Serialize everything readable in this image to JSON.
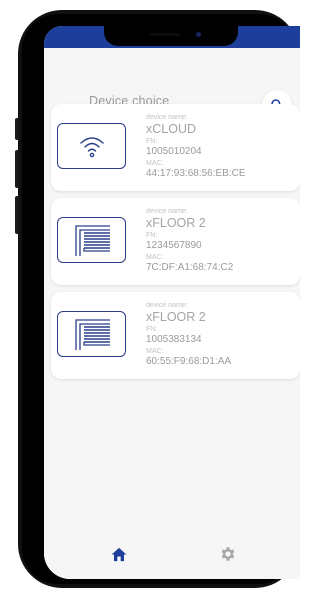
{
  "header": {
    "title": "Device choice"
  },
  "devices": [
    {
      "name_label": "device name:",
      "name": "xCLOUD",
      "fn_label": "FN:",
      "fn": "1005010204",
      "mac_label": "MAC:",
      "mac": "44:17:93:68:56:EB:CE",
      "icon": "wifi-icon"
    },
    {
      "name_label": "device name:",
      "name": "xFLOOR 2",
      "fn_label": "FN:",
      "fn": "1234567890",
      "mac_label": "MAC:",
      "mac": "7C:DF:A1:68:74:C2",
      "icon": "floor-heating-icon"
    },
    {
      "name_label": "device name:",
      "name": "xFLOOR 2",
      "fn_label": "FN:",
      "fn": "1005383134",
      "mac_label": "MAC:",
      "mac": "60:55:F9:68:D1:AA",
      "icon": "floor-heating-icon"
    }
  ],
  "tabbar": {
    "home_icon": "home-icon",
    "settings_icon": "gear-icon"
  },
  "colors": {
    "accent": "#1d3e9a",
    "background": "#f6f6f6",
    "card": "#ffffff",
    "text_muted": "#9a9a9a"
  }
}
